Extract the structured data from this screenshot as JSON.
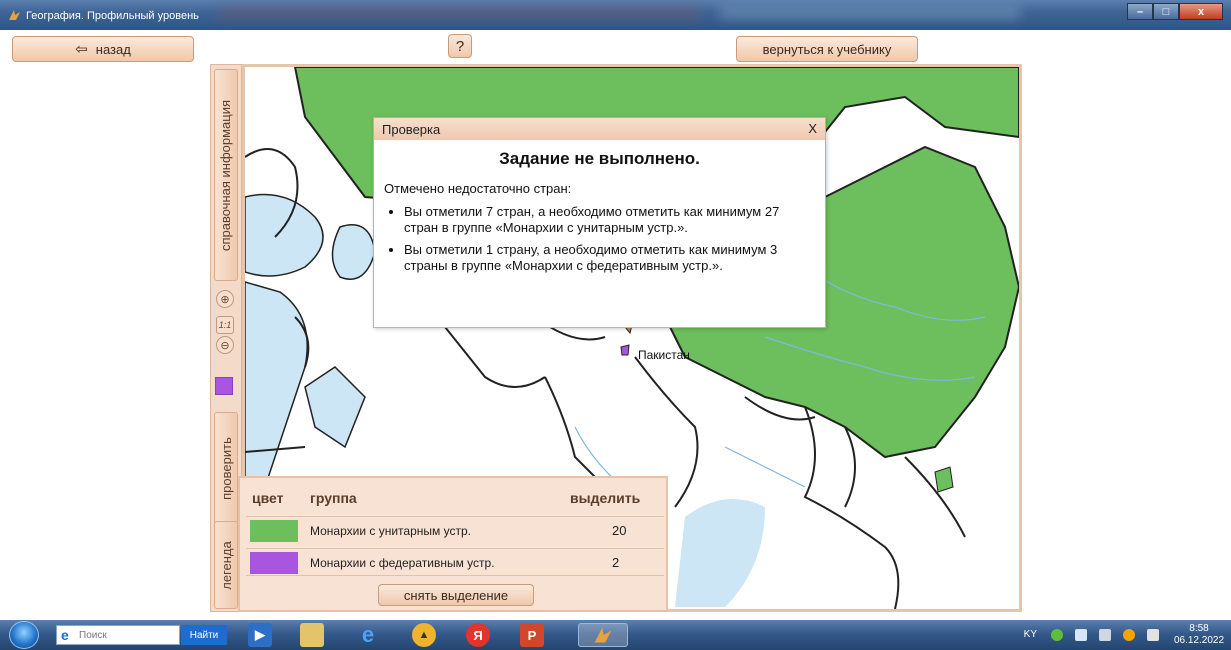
{
  "window": {
    "title": "География. Профильный уровень"
  },
  "toolbar": {
    "back_label": "назад",
    "help_label": "?",
    "return_label": "вернуться к учебнику"
  },
  "side_panel": {
    "info_tab": "справочная информация",
    "zoom_in": "⊕",
    "zoom_reset": "1:1",
    "zoom_out": "⊖",
    "check_tab": "проверить",
    "legend_tab": "легенда",
    "current_color": "#a855e0"
  },
  "map": {
    "label_pakistan": "Пакистан",
    "colors": {
      "monarchy_unitary": "#6cbf5c",
      "monarchy_federal": "#a855e0",
      "water": "#cce6f6"
    }
  },
  "dialog": {
    "title": "Проверка",
    "close": "X",
    "heading": "Задание не выполнено.",
    "subtitle": "Отмечено недостаточно стран:",
    "items": [
      "Вы отметили 7 стран, а необходимо отметить как минимум 27 стран в группе «Монархии с унитарным устр.».",
      "Вы отметили 1 страну, а необходимо отметить как минимум 3 страны в группе «Монархии с федеративным устр.»."
    ]
  },
  "legend": {
    "header_color": "цвет",
    "header_group": "группа",
    "header_select": "выделить",
    "rows": [
      {
        "color": "#6cbf5c",
        "label": "Монархии с унитарным устр.",
        "count": "20"
      },
      {
        "color": "#a855e0",
        "label": "Монархии с федеративным устр.",
        "count": "2"
      }
    ],
    "clear_button": "снять выделение"
  },
  "taskbar": {
    "search_placeholder": "Поиск",
    "search_button": "Найти",
    "language": "KY",
    "time": "8:58",
    "date": "06.12.2022"
  }
}
